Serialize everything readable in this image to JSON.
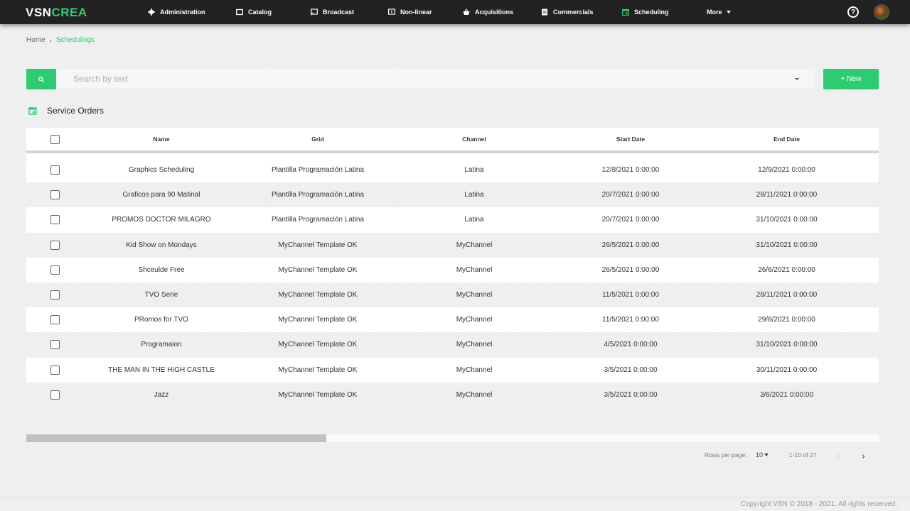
{
  "brand": {
    "part1": "VSN",
    "part2": "CREA"
  },
  "nav": {
    "items": [
      {
        "label": "Administration",
        "icon": "gear-icon"
      },
      {
        "label": "Catalog",
        "icon": "folder-icon"
      },
      {
        "label": "Broadcast",
        "icon": "cast-icon"
      },
      {
        "label": "Non-linear",
        "icon": "play-screen-icon"
      },
      {
        "label": "Acquisitions",
        "icon": "basket-icon"
      },
      {
        "label": "Commercials",
        "icon": "document-icon"
      },
      {
        "label": "Scheduling",
        "icon": "calendar-icon"
      },
      {
        "label": "More",
        "icon": "chevron-down-icon"
      }
    ],
    "help_symbol": "?",
    "active_color": "#2ecc71"
  },
  "breadcrumb": {
    "home": "Home",
    "current": "Schedulings"
  },
  "search": {
    "placeholder": "Search by text"
  },
  "new_button": {
    "label": "+ New"
  },
  "section": {
    "title": "Service Orders"
  },
  "table": {
    "headers": {
      "name": "Name",
      "grid": "Grid",
      "channel": "Channel",
      "start": "Start Date",
      "end": "End Date"
    },
    "rows": [
      {
        "name": "Graphics Scheduling",
        "grid": "Plantilla Programación Latina",
        "channel": "Latina",
        "start": "12/8/2021 0:00:00",
        "end": "12/9/2021 0:00:00"
      },
      {
        "name": "Graficos para 90 Matinal",
        "grid": "Plantilla Programación Latina",
        "channel": "Latina",
        "start": "20/7/2021 0:00:00",
        "end": "28/11/2021 0:00:00"
      },
      {
        "name": "PROMOS DOCTOR MILAGRO",
        "grid": "Plantilla Programación Latina",
        "channel": "Latina",
        "start": "20/7/2021 0:00:00",
        "end": "31/10/2021 0:00:00"
      },
      {
        "name": "Kid Show on Mondays",
        "grid": "MyChannel Template OK",
        "channel": "MyChannel",
        "start": "26/5/2021 0:00:00",
        "end": "31/10/2021 0:00:00"
      },
      {
        "name": "Shceulde Free",
        "grid": "MyChannel Template OK",
        "channel": "MyChannel",
        "start": "26/5/2021 0:00:00",
        "end": "26/6/2021 0:00:00"
      },
      {
        "name": "TVO Serie",
        "grid": "MyChannel Template OK",
        "channel": "MyChannel",
        "start": "11/5/2021 0:00:00",
        "end": "28/11/2021 0:00:00"
      },
      {
        "name": "PRomos for TVO",
        "grid": "MyChannel Template OK",
        "channel": "MyChannel",
        "start": "11/5/2021 0:00:00",
        "end": "29/8/2021 0:00:00"
      },
      {
        "name": "Programaion",
        "grid": "MyChannel Template OK",
        "channel": "MyChannel",
        "start": "4/5/2021 0:00:00",
        "end": "31/10/2021 0:00:00"
      },
      {
        "name": "THE MAN IN THE HIGH CASTLE",
        "grid": "MyChannel Template OK",
        "channel": "MyChannel",
        "start": "3/5/2021 0:00:00",
        "end": "30/11/2021 0:00:00"
      },
      {
        "name": "Jazz",
        "grid": "MyChannel Template OK",
        "channel": "MyChannel",
        "start": "3/5/2021 0:00:00",
        "end": "3/6/2021 0:00:00"
      }
    ]
  },
  "pagination": {
    "rows_label": "Rows per page:",
    "rows_value": "10",
    "range": "1-10 of 27",
    "prev": "‹",
    "next": "›"
  },
  "footer": {
    "text": "Copyright VSN © 2018 - 2021. All rights reserved."
  }
}
